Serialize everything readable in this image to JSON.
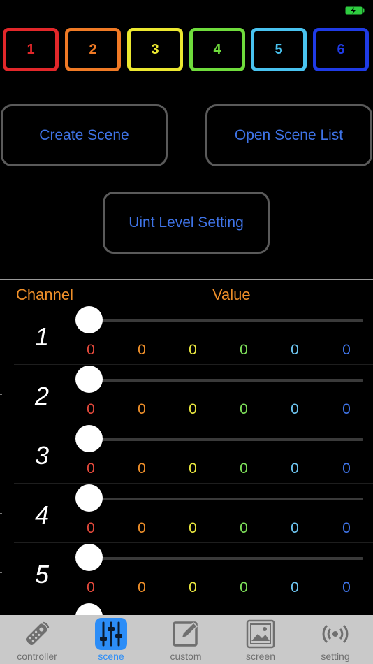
{
  "status": {
    "battery_icon": "battery-charging-icon"
  },
  "groups": [
    {
      "label": "1",
      "color": "#e2272a"
    },
    {
      "label": "2",
      "color": "#f07a25"
    },
    {
      "label": "3",
      "color": "#ece830"
    },
    {
      "label": "4",
      "color": "#6fdc3c"
    },
    {
      "label": "5",
      "color": "#49c3f0"
    },
    {
      "label": "6",
      "color": "#1f3be6"
    }
  ],
  "buttons": {
    "create_scene": "Create Scene",
    "open_scene_list": "Open Scene List",
    "unit_level_setting": "Uint Level Setting"
  },
  "table": {
    "channel_header": "Channel",
    "value_header": "Value",
    "value_colors": [
      "#e64a3c",
      "#f0902a",
      "#ecea40",
      "#7ee05a",
      "#6ec6f2",
      "#3f74e8"
    ],
    "channels": [
      {
        "label": "1",
        "level": 0,
        "values": [
          "0",
          "0",
          "0",
          "0",
          "0",
          "0"
        ]
      },
      {
        "label": "2",
        "level": 0,
        "values": [
          "0",
          "0",
          "0",
          "0",
          "0",
          "0"
        ]
      },
      {
        "label": "3",
        "level": 0,
        "values": [
          "0",
          "0",
          "0",
          "0",
          "0",
          "0"
        ]
      },
      {
        "label": "4",
        "level": 0,
        "values": [
          "0",
          "0",
          "0",
          "0",
          "0",
          "0"
        ]
      },
      {
        "label": "5",
        "level": 0,
        "values": [
          "0",
          "0",
          "0",
          "0",
          "0",
          "0"
        ]
      },
      {
        "label": "",
        "level": 0,
        "values": [
          "",
          "",
          "",
          "",
          "",
          ""
        ]
      }
    ]
  },
  "tabbar": {
    "active": "scene",
    "tabs": [
      {
        "key": "controller",
        "label": "controller",
        "icon": "remote-control-icon"
      },
      {
        "key": "scene",
        "label": "scene",
        "icon": "sliders-icon"
      },
      {
        "key": "custom",
        "label": "custom",
        "icon": "edit-icon"
      },
      {
        "key": "screen",
        "label": "screen",
        "icon": "picture-icon"
      },
      {
        "key": "setting",
        "label": "setting",
        "icon": "broadcast-icon"
      }
    ]
  }
}
